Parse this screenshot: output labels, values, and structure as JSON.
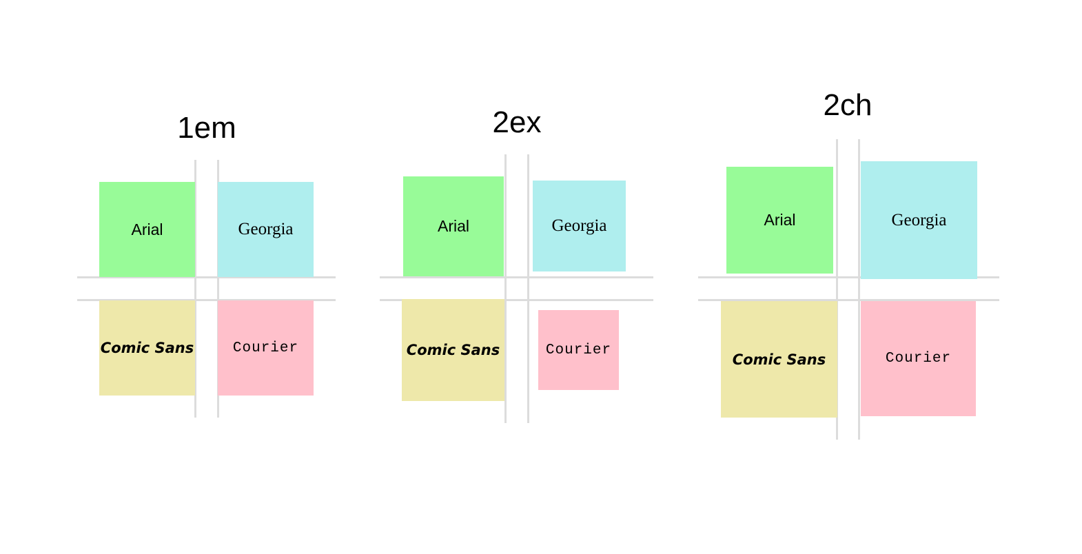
{
  "groups": [
    {
      "title": "1em",
      "labels": [
        "Arial",
        "Georgia",
        "Comic Sans",
        "Courier"
      ]
    },
    {
      "title": "2ex",
      "labels": [
        "Arial",
        "Georgia",
        "Comic Sans",
        "Courier"
      ]
    },
    {
      "title": "2ch",
      "labels": [
        "Arial",
        "Georgia",
        "Comic Sans",
        "Courier"
      ]
    }
  ],
  "colors": {
    "arial": "#98fb98",
    "georgia": "#afeeee",
    "comic_sans": "#eee8aa",
    "courier": "#ffc0cb",
    "guide_lines": "#dcdcdc"
  }
}
